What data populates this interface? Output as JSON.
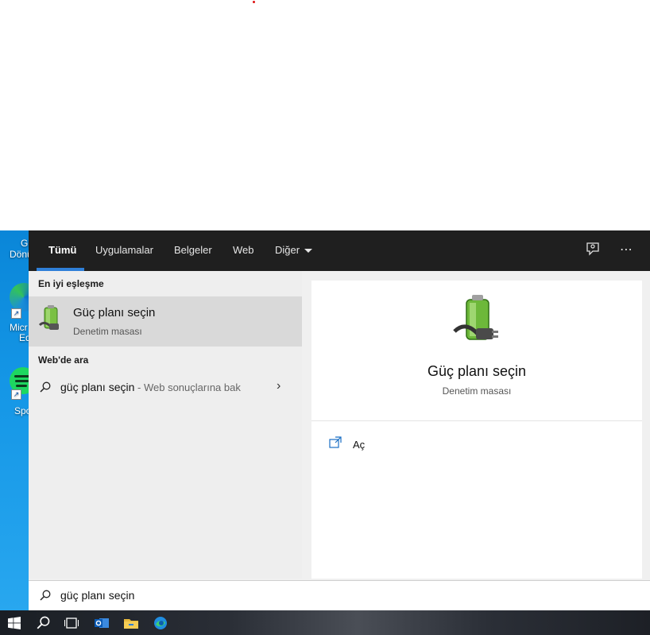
{
  "tabs": [
    {
      "label": "Tümü",
      "active": true
    },
    {
      "label": "Uygulamalar"
    },
    {
      "label": "Belgeler"
    },
    {
      "label": "Web"
    },
    {
      "label": "Diğer"
    }
  ],
  "toolbar_icons": [
    "feedback-icon",
    "more-icon"
  ],
  "left": {
    "best_match_header": "En iyi eşleşme",
    "best_match": {
      "title": "Güç planı seçin",
      "subtitle": "Denetim masası",
      "icon": "power-plan-icon"
    },
    "web_header": "Web'de ara",
    "web_result": {
      "query": "güç planı seçin",
      "suffix": " - Web sonuçlarına bak"
    }
  },
  "preview": {
    "title": "Güç planı seçin",
    "subtitle": "Denetim masası",
    "actions": [
      {
        "label": "Aç",
        "icon": "open-icon"
      }
    ]
  },
  "search": {
    "value": "güç planı seçin"
  },
  "desktop": {
    "items": [
      {
        "label_lines": [
          "Gı",
          "Dönü"
        ]
      },
      {
        "label_lines": [
          "Micr",
          "Ed"
        ]
      },
      {
        "label_lines": [
          "Spo"
        ]
      }
    ]
  },
  "taskbar": [
    "windows-start-icon",
    "search-icon",
    "task-view-icon",
    "outlook-icon",
    "file-explorer-icon",
    "edge-icon"
  ],
  "colors": {
    "tab_underline": "#2f7fd8",
    "tabbar_bg": "#1f1f1f",
    "best_match_bg": "#d9d9d9"
  }
}
